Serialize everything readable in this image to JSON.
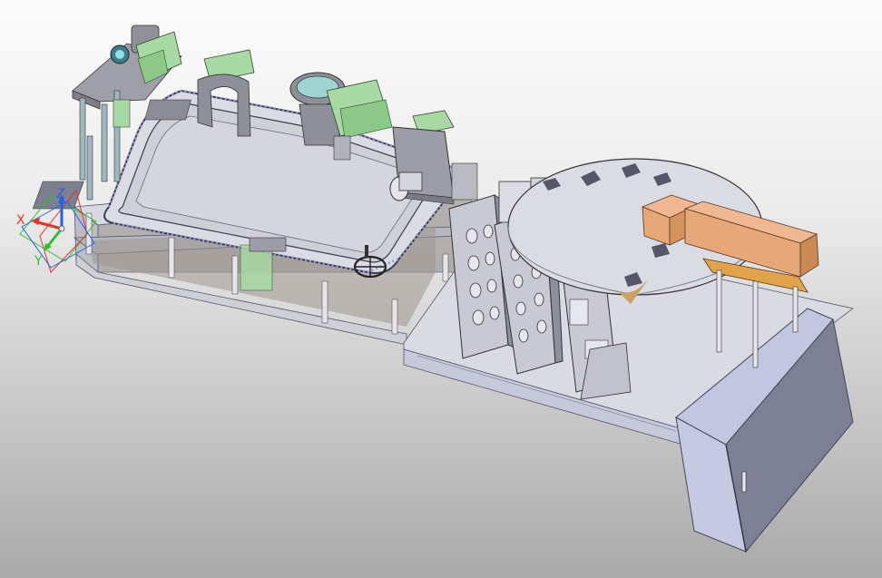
{
  "viewport": {
    "background_top": "#fbfbfb",
    "background_bottom": "#a9a9a9"
  },
  "triad": {
    "x_label": "X",
    "y_label": "Y",
    "z_label": "Z",
    "x_color": "#e8312a",
    "y_color": "#2ec02e",
    "z_color": "#2a5ee8"
  },
  "palette": {
    "steel": "#c9cad6",
    "steel_dark": "#8f90a0",
    "cabinet": "#c3c6e0",
    "cabinet_dark": "#8e90ac",
    "motor_green": "#a8d8a4",
    "bowl_teal": "#9fd4d2",
    "tray_orange": "#e0a070"
  }
}
